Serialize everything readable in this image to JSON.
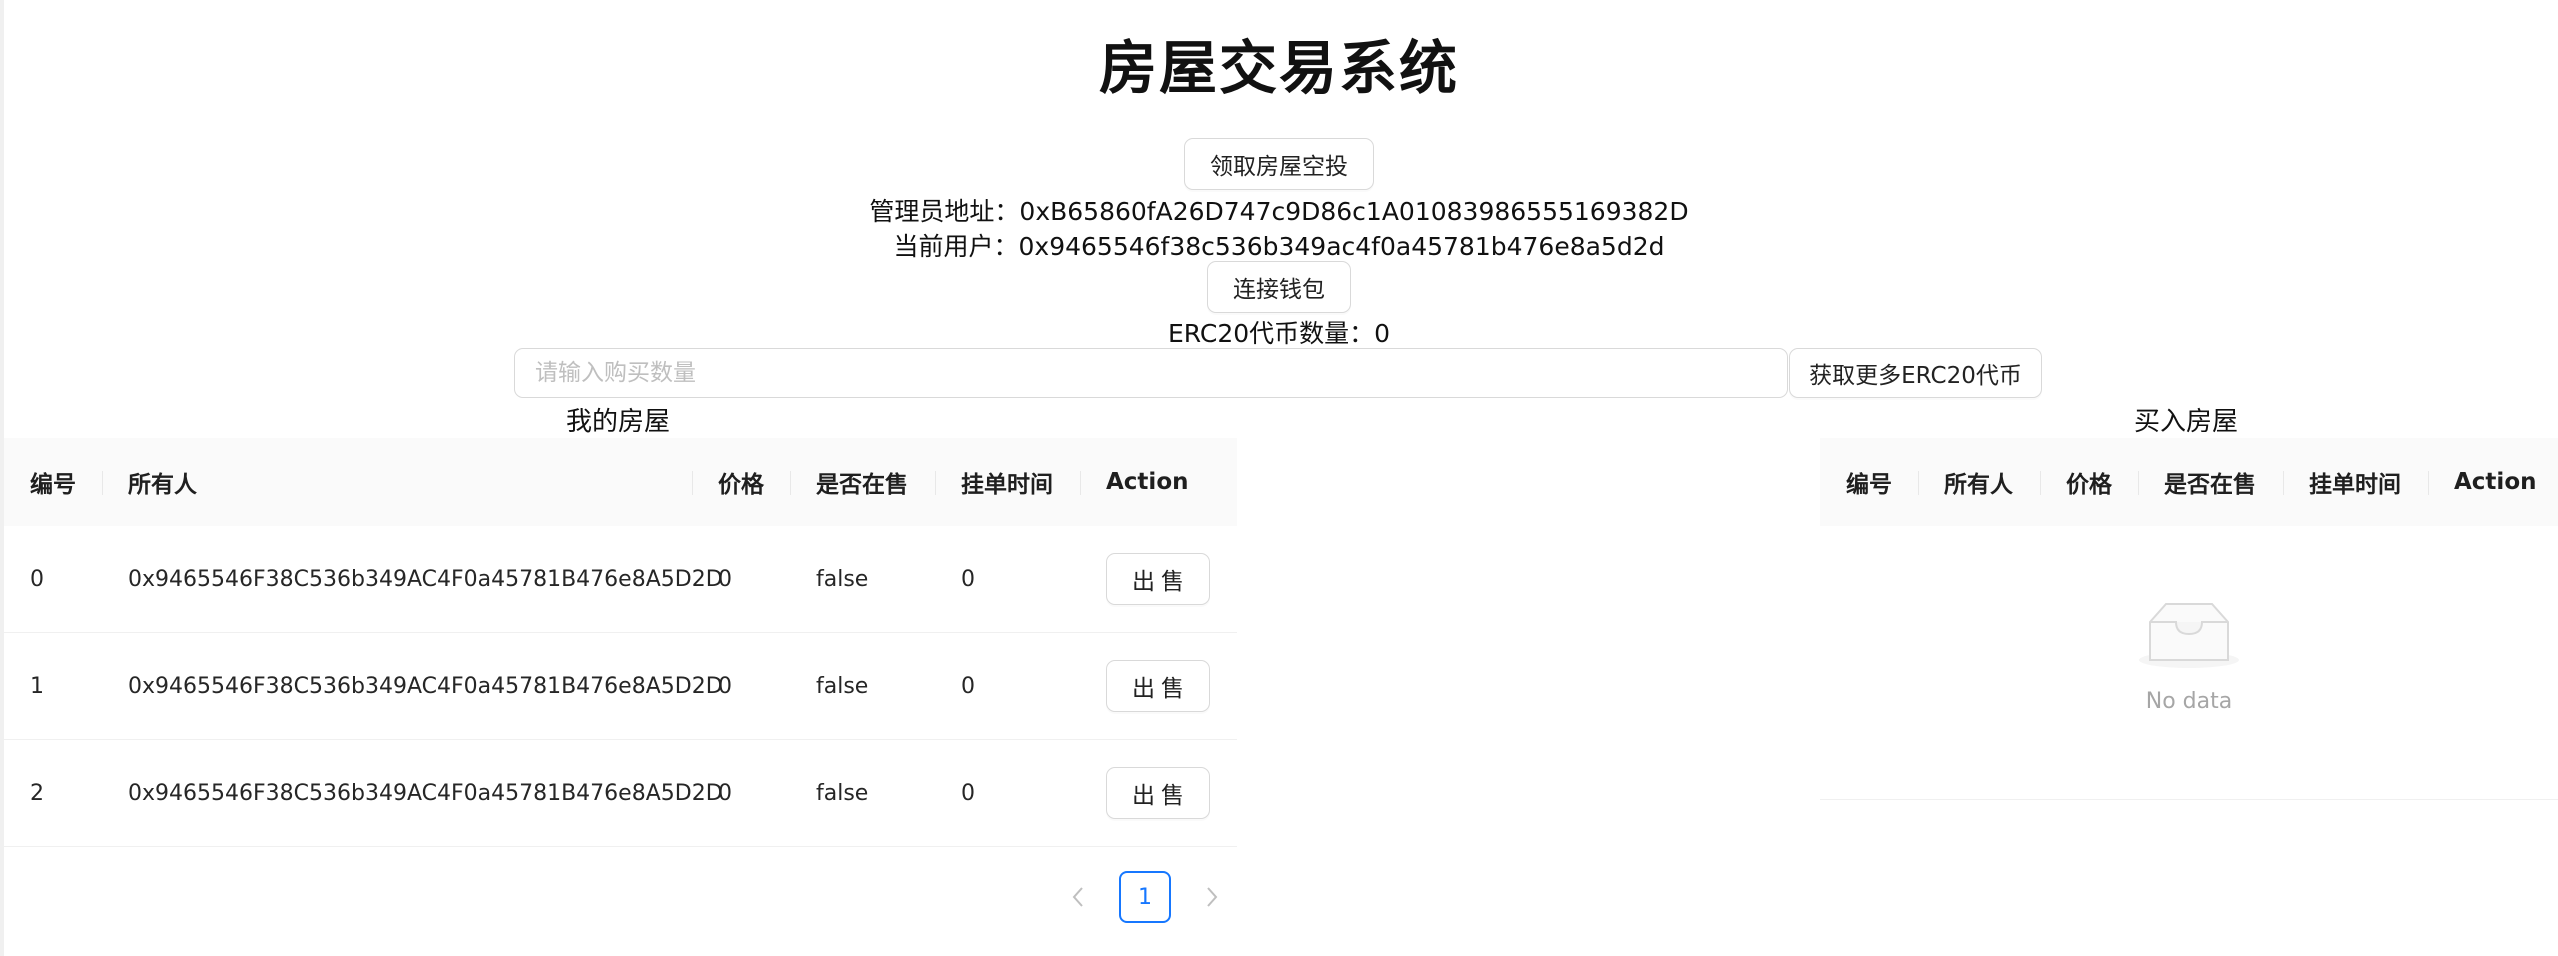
{
  "page": {
    "title": "房屋交易系统"
  },
  "actions": {
    "airdrop_label": "领取房屋空投",
    "connect_wallet_label": "连接钱包",
    "get_more_erc20_label": "获取更多ERC20代币"
  },
  "info": {
    "manager_line": "管理员地址：0xB65860fA26D747c9D86c1A01083986555169382D",
    "current_user_line": "当前用户：0x9465546f38c536b349ac4f0a45781b476e8a5d2d",
    "erc20_line": "ERC20代币数量：0"
  },
  "buy_input": {
    "placeholder": "请输入购买数量",
    "value": ""
  },
  "my_houses": {
    "title": "我的房屋",
    "columns": [
      "编号",
      "所有人",
      "价格",
      "是否在售",
      "挂单时间",
      "Action"
    ],
    "rows": [
      {
        "id": "0",
        "owner": "0x9465546F38C536b349AC4F0a45781B476e8A5D2D",
        "price": "0",
        "on_sale": "false",
        "list_time": "0",
        "action": "出售"
      },
      {
        "id": "1",
        "owner": "0x9465546F38C536b349AC4F0a45781B476e8A5D2D",
        "price": "0",
        "on_sale": "false",
        "list_time": "0",
        "action": "出售"
      },
      {
        "id": "2",
        "owner": "0x9465546F38C536b349AC4F0a45781B476e8A5D2D",
        "price": "0",
        "on_sale": "false",
        "list_time": "0",
        "action": "出售"
      }
    ],
    "pagination": {
      "prev_icon": "chevron-left-icon",
      "current_page": "1",
      "next_icon": "chevron-right-icon"
    }
  },
  "buy_houses": {
    "title": "买入房屋",
    "columns": [
      "编号",
      "所有人",
      "价格",
      "是否在售",
      "挂单时间",
      "Action"
    ],
    "empty_icon": "empty-inbox-icon",
    "empty_text": "No data"
  },
  "colors": {
    "primary": "#1677ff",
    "border": "#d9d9d9",
    "header_bg": "#fafafa",
    "muted_text": "#a6a6a6"
  }
}
